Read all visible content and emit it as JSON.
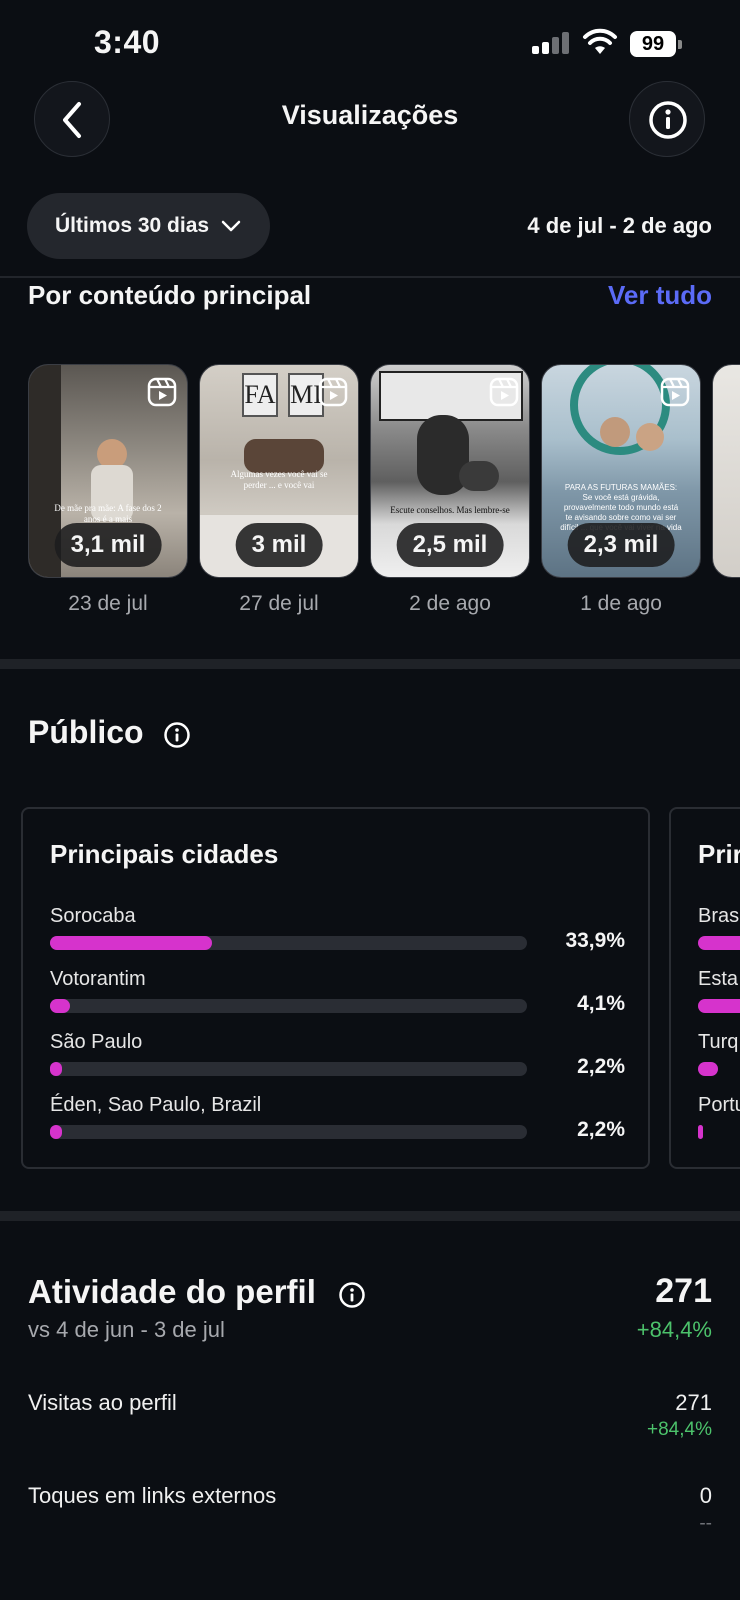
{
  "status_bar": {
    "time": "3:40",
    "battery": "99",
    "icons": [
      "cellular-signal-icon",
      "wifi-icon",
      "battery-icon"
    ]
  },
  "header": {
    "title": "Visualizações",
    "back_icon": "chevron-left-icon",
    "info_icon": "info-icon"
  },
  "filter": {
    "period_label": "Últimos 30 dias",
    "date_range": "4 de jul - 2 de ago"
  },
  "top_content": {
    "title": "Por conteúdo principal",
    "see_all": "Ver tudo",
    "items": [
      {
        "views": "3,1 mil",
        "date": "23 de jul",
        "caption": "De mãe pra mãe: A fase dos 2 anos é a mais"
      },
      {
        "views": "3 mil",
        "date": "27 de jul",
        "caption": "Algumas vezes você vai se perder ... e você vai"
      },
      {
        "views": "2,5 mil",
        "date": "2 de ago",
        "caption": "Escute conselhos. Mas lembre-se"
      },
      {
        "views": "2,3 mil",
        "date": "1 de ago",
        "caption": "PARA AS FUTURAS MAMÃES: Se você está grávida, provavelmente todo mundo está te avisando sobre como vai ser difícil ... que você vai viver na vida"
      }
    ]
  },
  "audience": {
    "title": "Público",
    "top_cities": {
      "title": "Principais cidades",
      "rows": [
        {
          "name": "Sorocaba",
          "percent": "33,9%",
          "fraction": 0.339
        },
        {
          "name": "Votorantim",
          "percent": "4,1%",
          "fraction": 0.041
        },
        {
          "name": "São Paulo",
          "percent": "2,2%",
          "fraction": 0.022
        },
        {
          "name": "Éden, Sao Paulo, Brazil",
          "percent": "2,2%",
          "fraction": 0.022
        }
      ]
    },
    "next_card": {
      "title_partial": "Prir",
      "rows": [
        {
          "name_partial": "Bras"
        },
        {
          "name_partial": "Esta"
        },
        {
          "name_partial": "Turq"
        },
        {
          "name_partial": "Portu"
        }
      ]
    }
  },
  "profile_activity": {
    "title": "Atividade do perfil",
    "compare": "vs 4 de jun - 3 de jul",
    "total": "271",
    "change": "+84,4%",
    "metrics": [
      {
        "label": "Visitas ao perfil",
        "value": "271",
        "change": "+84,4%"
      },
      {
        "label": "Toques em links externos",
        "value": "0",
        "change": "--"
      }
    ]
  },
  "colors": {
    "background": "#0b0e13",
    "accent_link": "#5b6bf7",
    "bar_fill": "#d633cc",
    "positive": "#4cc26b"
  }
}
